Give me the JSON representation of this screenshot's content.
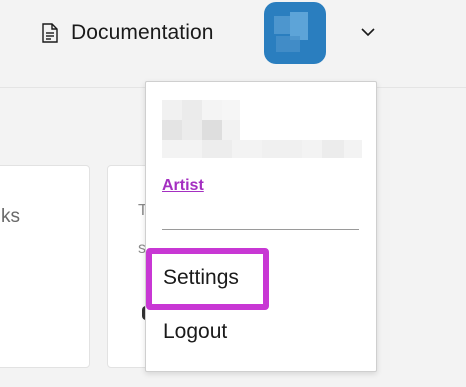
{
  "header": {
    "documentation_label": "Documentation",
    "doc_icon": "document-icon",
    "avatar_icon": "user-avatar",
    "menu_toggle_icon": "chevron-down-icon"
  },
  "background_cards": [
    {
      "text": "ks"
    },
    {
      "text": "T",
      "text2": "s"
    }
  ],
  "user_menu": {
    "role_link": "Artist",
    "items": [
      {
        "label": "Settings",
        "highlighted": true
      },
      {
        "label": "Logout"
      }
    ]
  },
  "colors": {
    "background": "#f3f3f3",
    "avatar_blue": "#2a7ebf",
    "link_purple": "#a42fc1",
    "highlight_magenta": "#c837d4"
  }
}
